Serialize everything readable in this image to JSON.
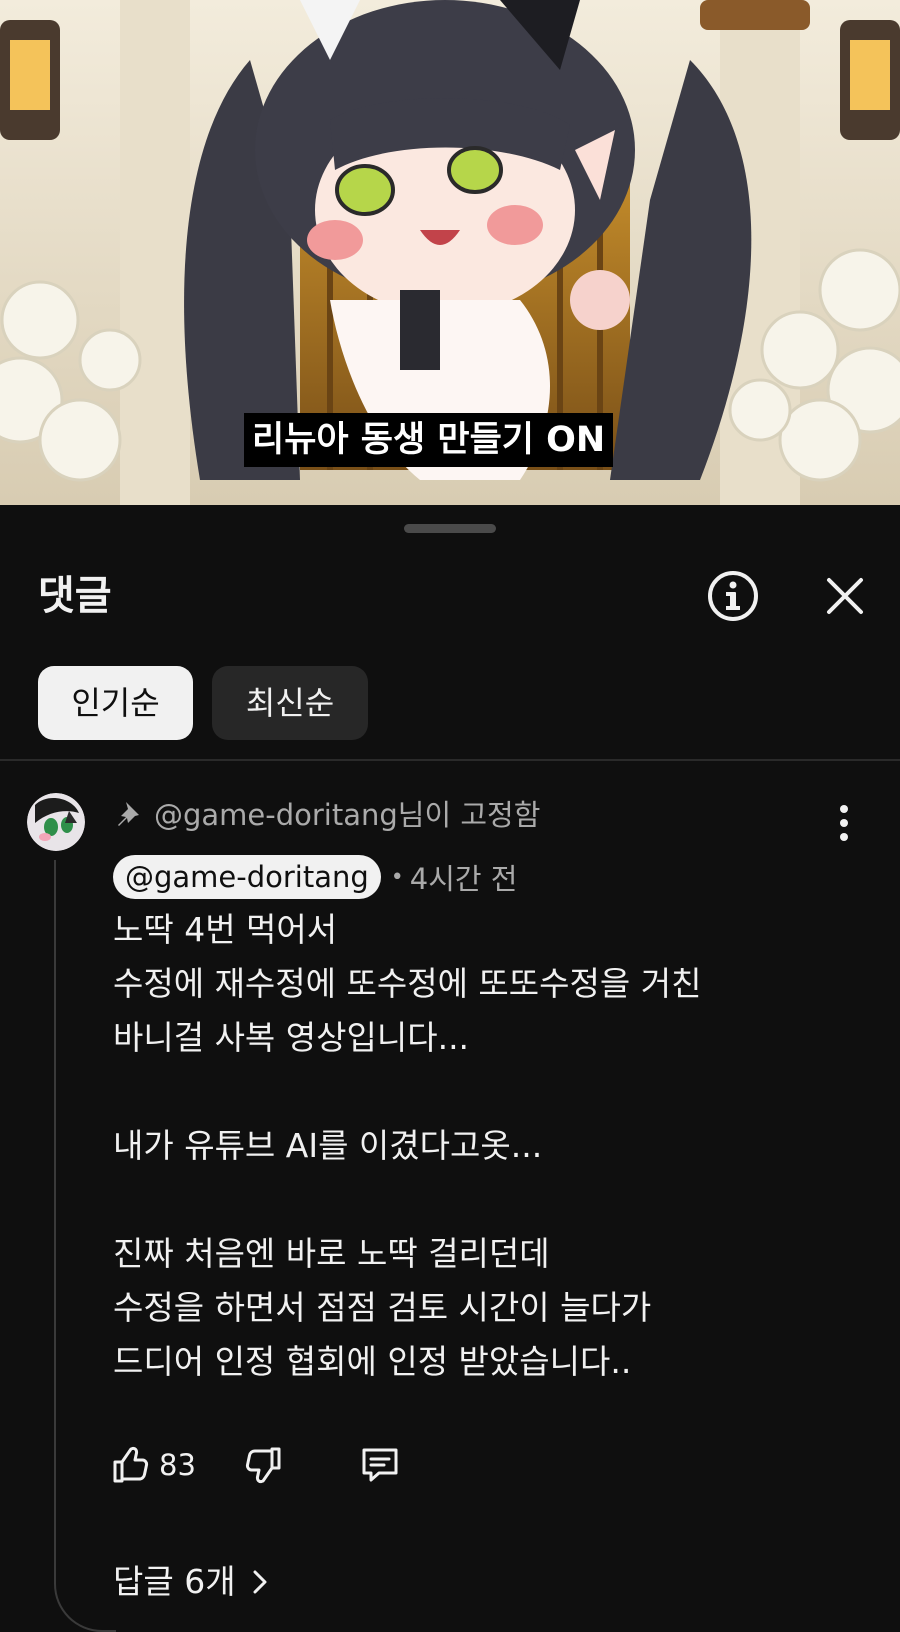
{
  "video": {
    "caption": "리뉴아 동생 만들기 ON"
  },
  "comments_panel": {
    "title": "댓글",
    "info_icon": "info-circle-icon",
    "close_icon": "close-icon",
    "sort_tabs": [
      {
        "label": "인기순",
        "selected": true
      },
      {
        "label": "최신순",
        "selected": false
      }
    ]
  },
  "comment": {
    "pinned_text": "@game-doritang님이 고정함",
    "author": "@game-doritang",
    "time": "4시간 전",
    "body_lines": [
      "노딱 4번 먹어서",
      "수정에 재수정에 또수정에 또또수정을 거친",
      "바니걸 사복 영상입니다...",
      "",
      "내가 유튜브 AI를 이겼다고옷...",
      "",
      "진짜 처음엔 바로 노딱 걸리던데",
      "수정을 하면서 점점 검토 시간이 늘다가",
      "드디어 인정 협회에 인정 받았습니다.."
    ],
    "likes": "83",
    "replies_label": "답글 6개"
  },
  "colors": {
    "background": "#0f0f0f",
    "text": "#f1f1f1",
    "secondary_text": "#aaaaaa",
    "chip_idle": "#272727"
  }
}
